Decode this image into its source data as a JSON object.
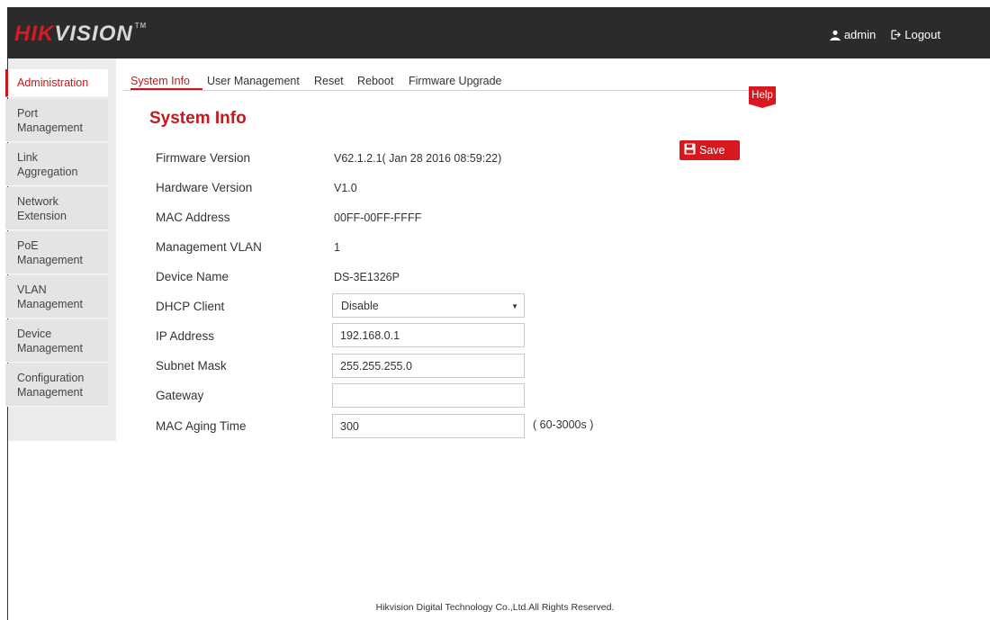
{
  "brand": {
    "logo_red": "HIK",
    "logo_rest": "VISION",
    "tm": "TM"
  },
  "header": {
    "user": "admin",
    "logout": "Logout"
  },
  "sidebar": {
    "items": [
      {
        "label": "Administration",
        "active": true
      },
      {
        "label": "Port Management",
        "lines": [
          "Port",
          "Management"
        ]
      },
      {
        "label": "Link Aggregation",
        "lines": [
          "Link",
          "Aggregation"
        ]
      },
      {
        "label": "Network Extension",
        "lines": [
          "Network",
          "Extension"
        ]
      },
      {
        "label": "PoE Management",
        "lines": [
          "PoE",
          "Management"
        ]
      },
      {
        "label": "VLAN Management",
        "lines": [
          "VLAN",
          "Management"
        ]
      },
      {
        "label": "Device Management",
        "lines": [
          "Device",
          "Management"
        ]
      },
      {
        "label": "Configuration Management",
        "lines": [
          "Configuration",
          "Management"
        ]
      }
    ]
  },
  "tabs": [
    {
      "label": "System Info",
      "active": true
    },
    {
      "label": "User Management"
    },
    {
      "label": "Reset"
    },
    {
      "label": "Reboot"
    },
    {
      "label": "Firmware Upgrade"
    }
  ],
  "help_label": "Help",
  "main": {
    "title": "System Info",
    "save_label": "Save",
    "fields": {
      "firmware": {
        "label": "Firmware Version",
        "value": "V62.1.2.1( Jan 28 2016 08:59:22)"
      },
      "hardware": {
        "label": "Hardware Version",
        "value": "V1.0"
      },
      "mac": {
        "label": "MAC Address",
        "value": "00FF-00FF-FFFF"
      },
      "mgmt_vlan": {
        "label": "Management VLAN",
        "value": "1"
      },
      "device_name": {
        "label": "Device Name",
        "value": "DS-3E1326P"
      },
      "dhcp": {
        "label": "DHCP Client",
        "value": "Disable"
      },
      "ip": {
        "label": "IP Address",
        "value": "192.168.0.1"
      },
      "subnet": {
        "label": "Subnet Mask",
        "value": "255.255.255.0"
      },
      "gateway": {
        "label": "Gateway",
        "value": ""
      },
      "mac_aging": {
        "label": "MAC Aging Time",
        "value": "300",
        "hint": "( 60-3000s )"
      }
    }
  },
  "footer": "Hikvision Digital Technology Co.,Ltd.All Rights Reserved.",
  "colors": {
    "accent": "#c8161d",
    "topbar": "#2b2b2b",
    "sidebar": "#e4e4e4"
  },
  "icons": {
    "user": "user-icon",
    "logout": "logout-icon",
    "save": "floppy-disk-icon",
    "dropdown": "caret-down-icon"
  }
}
